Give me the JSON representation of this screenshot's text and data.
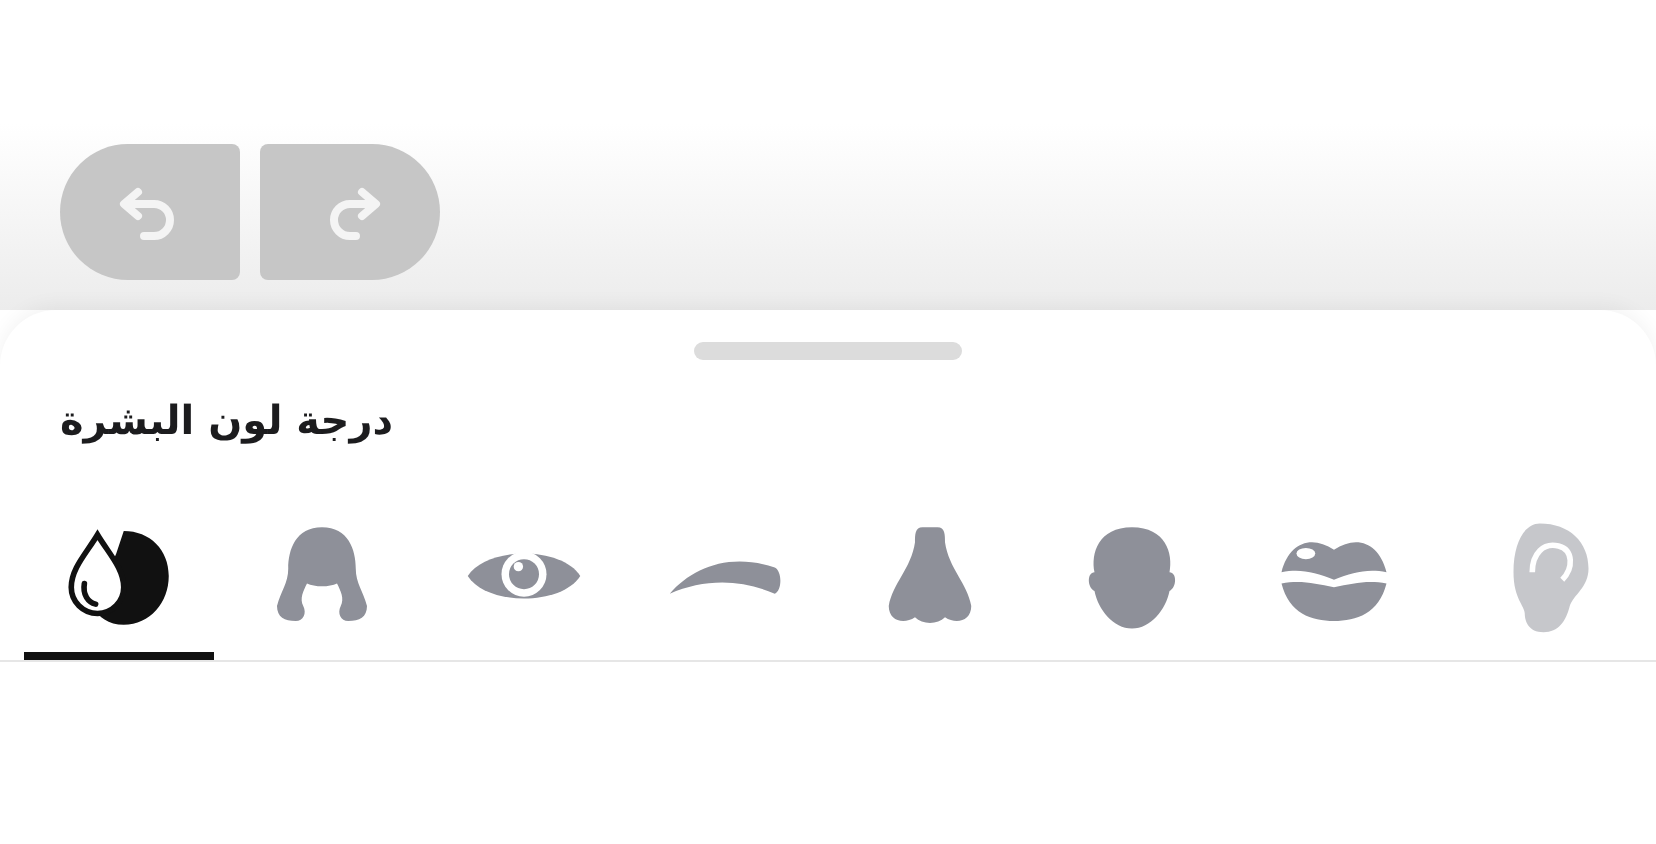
{
  "title": "درجة لون البشرة",
  "tabs": [
    {
      "kind": "skin",
      "selected": true
    },
    {
      "kind": "hair",
      "selected": false
    },
    {
      "kind": "eye",
      "selected": false
    },
    {
      "kind": "brow",
      "selected": false
    },
    {
      "kind": "nose",
      "selected": false
    },
    {
      "kind": "head",
      "selected": false
    },
    {
      "kind": "lips",
      "selected": false
    },
    {
      "kind": "ear",
      "selected": false
    }
  ]
}
